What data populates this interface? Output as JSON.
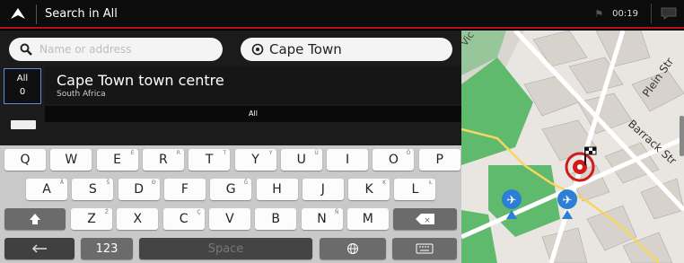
{
  "topbar": {
    "title": "Search in All",
    "time": "00:19"
  },
  "search": {
    "placeholder": "Name or address",
    "city": "Cape Town"
  },
  "category": {
    "label": "All",
    "count": "0"
  },
  "result": {
    "name": "Cape Town town centre",
    "sub": "South Africa"
  },
  "divider_label": "All",
  "keyboard": {
    "row1": [
      {
        "k": "Q",
        "s": ""
      },
      {
        "k": "W",
        "s": ""
      },
      {
        "k": "E",
        "s": "É"
      },
      {
        "k": "R",
        "s": "R"
      },
      {
        "k": "T",
        "s": "T"
      },
      {
        "k": "Y",
        "s": "Y"
      },
      {
        "k": "U",
        "s": "Ü"
      },
      {
        "k": "I",
        "s": ""
      },
      {
        "k": "O",
        "s": "Ö"
      },
      {
        "k": "P",
        "s": ""
      }
    ],
    "row2": [
      {
        "k": "A",
        "s": "Å"
      },
      {
        "k": "S",
        "s": "Š"
      },
      {
        "k": "D",
        "s": "Ð"
      },
      {
        "k": "F",
        "s": ""
      },
      {
        "k": "G",
        "s": "Ğ"
      },
      {
        "k": "H",
        "s": ""
      },
      {
        "k": "J",
        "s": ""
      },
      {
        "k": "K",
        "s": "Ķ"
      },
      {
        "k": "L",
        "s": "Ł"
      }
    ],
    "row3": [
      {
        "k": "Z",
        "s": "Ž"
      },
      {
        "k": "X",
        "s": ""
      },
      {
        "k": "C",
        "s": "Ç"
      },
      {
        "k": "V",
        "s": ""
      },
      {
        "k": "B",
        "s": ""
      },
      {
        "k": "N",
        "s": "Ñ"
      },
      {
        "k": "M",
        "s": ""
      }
    ],
    "numbers_label": "123",
    "space_label": "Space"
  },
  "map": {
    "streets": [
      "Vic",
      "Plein Str",
      "Barrack Str"
    ],
    "colors": {
      "park": "#5fba6d",
      "road": "#f6d660",
      "poi": "#2c7fd6",
      "destination": "#d11b1b"
    }
  },
  "icons": [
    "up-arrow-icon",
    "search-icon",
    "gps-icon",
    "shift-icon",
    "backspace-icon",
    "back-arrow-icon",
    "globe-icon",
    "keyboard-icon",
    "airport-icon",
    "destination-flag-icon"
  ]
}
